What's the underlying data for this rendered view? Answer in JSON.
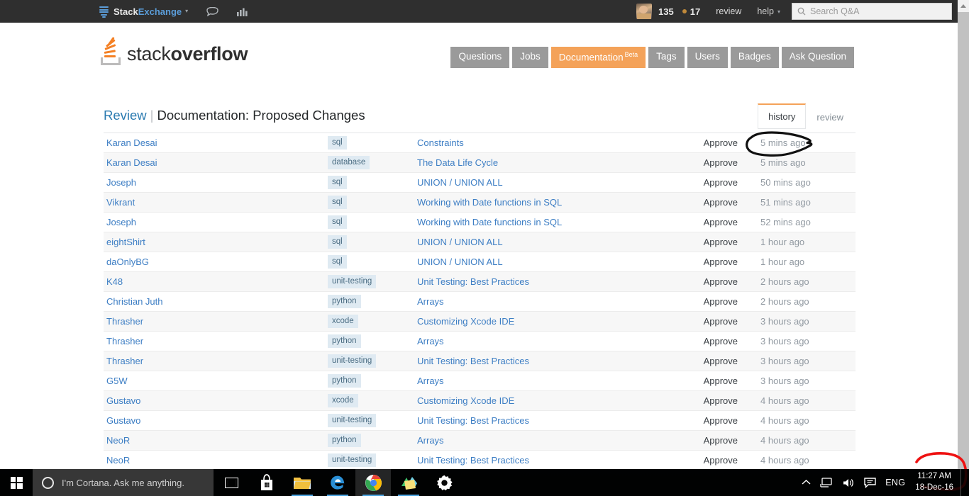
{
  "network_bar": {
    "brand_prefix": "Stack",
    "brand_suffix": "Exchange",
    "dropdown_caret": "▾",
    "inbox_icon": "inbox-icon",
    "achievements_icon": "achievements-icon",
    "reputation": "135",
    "badge_count": "17",
    "review_label": "review",
    "help_label": "help",
    "help_caret": "▾",
    "search_placeholder": "Search Q&A",
    "search_value": ""
  },
  "site_header": {
    "logo_text_light": "stack",
    "logo_text_bold": "overflow",
    "nav": [
      {
        "label": "Questions",
        "active": false,
        "beta": ""
      },
      {
        "label": "Jobs",
        "active": false,
        "beta": ""
      },
      {
        "label": "Documentation",
        "active": true,
        "beta": "Beta"
      },
      {
        "label": "Tags",
        "active": false,
        "beta": ""
      },
      {
        "label": "Users",
        "active": false,
        "beta": ""
      },
      {
        "label": "Badges",
        "active": false,
        "beta": ""
      },
      {
        "label": "Ask Question",
        "active": false,
        "beta": ""
      }
    ]
  },
  "page": {
    "breadcrumb_link": "Review",
    "breadcrumb_separator": "|",
    "title": "Documentation: Proposed Changes",
    "tabs": [
      {
        "label": "history",
        "active": true
      },
      {
        "label": "review",
        "active": false
      }
    ]
  },
  "review_table": {
    "rows": [
      {
        "user": "Karan Desai",
        "tag": "sql",
        "title": "Constraints",
        "action": "Approve",
        "time": "5 mins ago"
      },
      {
        "user": "Karan Desai",
        "tag": "database",
        "title": "The Data Life Cycle",
        "action": "Approve",
        "time": "5 mins ago"
      },
      {
        "user": "Joseph",
        "tag": "sql",
        "title": "UNION / UNION ALL",
        "action": "Approve",
        "time": "50 mins ago"
      },
      {
        "user": "Vikrant",
        "tag": "sql",
        "title": "Working with Date functions in SQL",
        "action": "Approve",
        "time": "51 mins ago"
      },
      {
        "user": "Joseph",
        "tag": "sql",
        "title": "Working with Date functions in SQL",
        "action": "Approve",
        "time": "52 mins ago"
      },
      {
        "user": "eightShirt",
        "tag": "sql",
        "title": "UNION / UNION ALL",
        "action": "Approve",
        "time": "1 hour ago"
      },
      {
        "user": "daOnlyBG",
        "tag": "sql",
        "title": "UNION / UNION ALL",
        "action": "Approve",
        "time": "1 hour ago"
      },
      {
        "user": "K48",
        "tag": "unit-testing",
        "title": "Unit Testing: Best Practices",
        "action": "Approve",
        "time": "2 hours ago"
      },
      {
        "user": "Christian Juth",
        "tag": "python",
        "title": "Arrays",
        "action": "Approve",
        "time": "2 hours ago"
      },
      {
        "user": "Thrasher",
        "tag": "xcode",
        "title": "Customizing Xcode IDE",
        "action": "Approve",
        "time": "3 hours ago"
      },
      {
        "user": "Thrasher",
        "tag": "python",
        "title": "Arrays",
        "action": "Approve",
        "time": "3 hours ago"
      },
      {
        "user": "Thrasher",
        "tag": "unit-testing",
        "title": "Unit Testing: Best Practices",
        "action": "Approve",
        "time": "3 hours ago"
      },
      {
        "user": "G5W",
        "tag": "python",
        "title": "Arrays",
        "action": "Approve",
        "time": "3 hours ago"
      },
      {
        "user": "Gustavo",
        "tag": "xcode",
        "title": "Customizing Xcode IDE",
        "action": "Approve",
        "time": "4 hours ago"
      },
      {
        "user": "Gustavo",
        "tag": "unit-testing",
        "title": "Unit Testing: Best Practices",
        "action": "Approve",
        "time": "4 hours ago"
      },
      {
        "user": "NeoR",
        "tag": "python",
        "title": "Arrays",
        "action": "Approve",
        "time": "4 hours ago"
      },
      {
        "user": "NeoR",
        "tag": "unit-testing",
        "title": "Unit Testing: Best Practices",
        "action": "Approve",
        "time": "4 hours ago"
      }
    ]
  },
  "annotations": [
    {
      "name": "black-ellipse-around-first-timestamp",
      "color": "#111111"
    },
    {
      "name": "red-outline-around-clock",
      "color": "#ee1111"
    }
  ],
  "taskbar": {
    "start_icon": "windows-start-icon",
    "cortana_placeholder": "I'm Cortana. Ask me anything.",
    "cortana_icon": "cortana-circle-icon",
    "apps": [
      {
        "name": "task-view-icon",
        "running": false
      },
      {
        "name": "microsoft-store-icon",
        "running": false
      },
      {
        "name": "file-explorer-icon",
        "running": true
      },
      {
        "name": "microsoft-edge-icon",
        "running": true
      },
      {
        "name": "google-chrome-icon",
        "running": true
      },
      {
        "name": "photos-icon",
        "running": true
      },
      {
        "name": "settings-gear-icon",
        "running": false
      }
    ],
    "tray": {
      "chevron": "︿",
      "network_icon": "network-icon",
      "volume_icon": "volume-icon",
      "action-center_icon": "action-center-icon",
      "language": "ENG",
      "time": "11:27 AM",
      "date": "18-Dec-16"
    }
  },
  "colors": {
    "accent_orange": "#f48024",
    "link_blue": "#3d7ec4",
    "topbar_dark": "#2f2f2f",
    "nav_grey": "#9a9a9a",
    "tag_bg": "#dfeaf2",
    "row_alt": "#f7f7f7",
    "annotation_black": "#111111",
    "annotation_red": "#ee1111"
  }
}
